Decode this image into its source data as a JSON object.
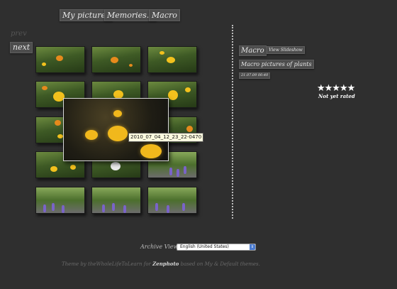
{
  "breadcrumbs": [
    "My pictures",
    "Memories...",
    "Macro"
  ],
  "nav": {
    "prev": "prev",
    "next": "next"
  },
  "thumbnails": [
    "marigolds-1",
    "marigolds-2",
    "marigolds-3",
    "marigolds-4",
    "marigolds-5",
    "marigolds-6",
    "marigolds-7",
    "marigolds-8",
    "marigolds-9",
    "lilies",
    "daisy",
    "lavender-path",
    "bench-1",
    "bench-2",
    "bench-3"
  ],
  "popup": {
    "tooltip": "2010_07_04_12_23_22-0470"
  },
  "album": {
    "title": "Macro",
    "slideshow_label": "View Slideshow",
    "description": "Macro pictures of plants",
    "date": "21.07.09 00:40"
  },
  "rating": {
    "stars": "★★★★★",
    "text": "Not yet rated"
  },
  "archive": {
    "label": "Archive View -",
    "language": "English (United States)"
  },
  "footer": {
    "prefix": "Theme by theWholeLifeToLearn for ",
    "brand": "Zenphoto",
    "suffix": " based on My & Default themes."
  },
  "colors": {
    "background": "#2f2f2f",
    "button": "#4d4d4d",
    "tooltip": "#fffde0"
  }
}
